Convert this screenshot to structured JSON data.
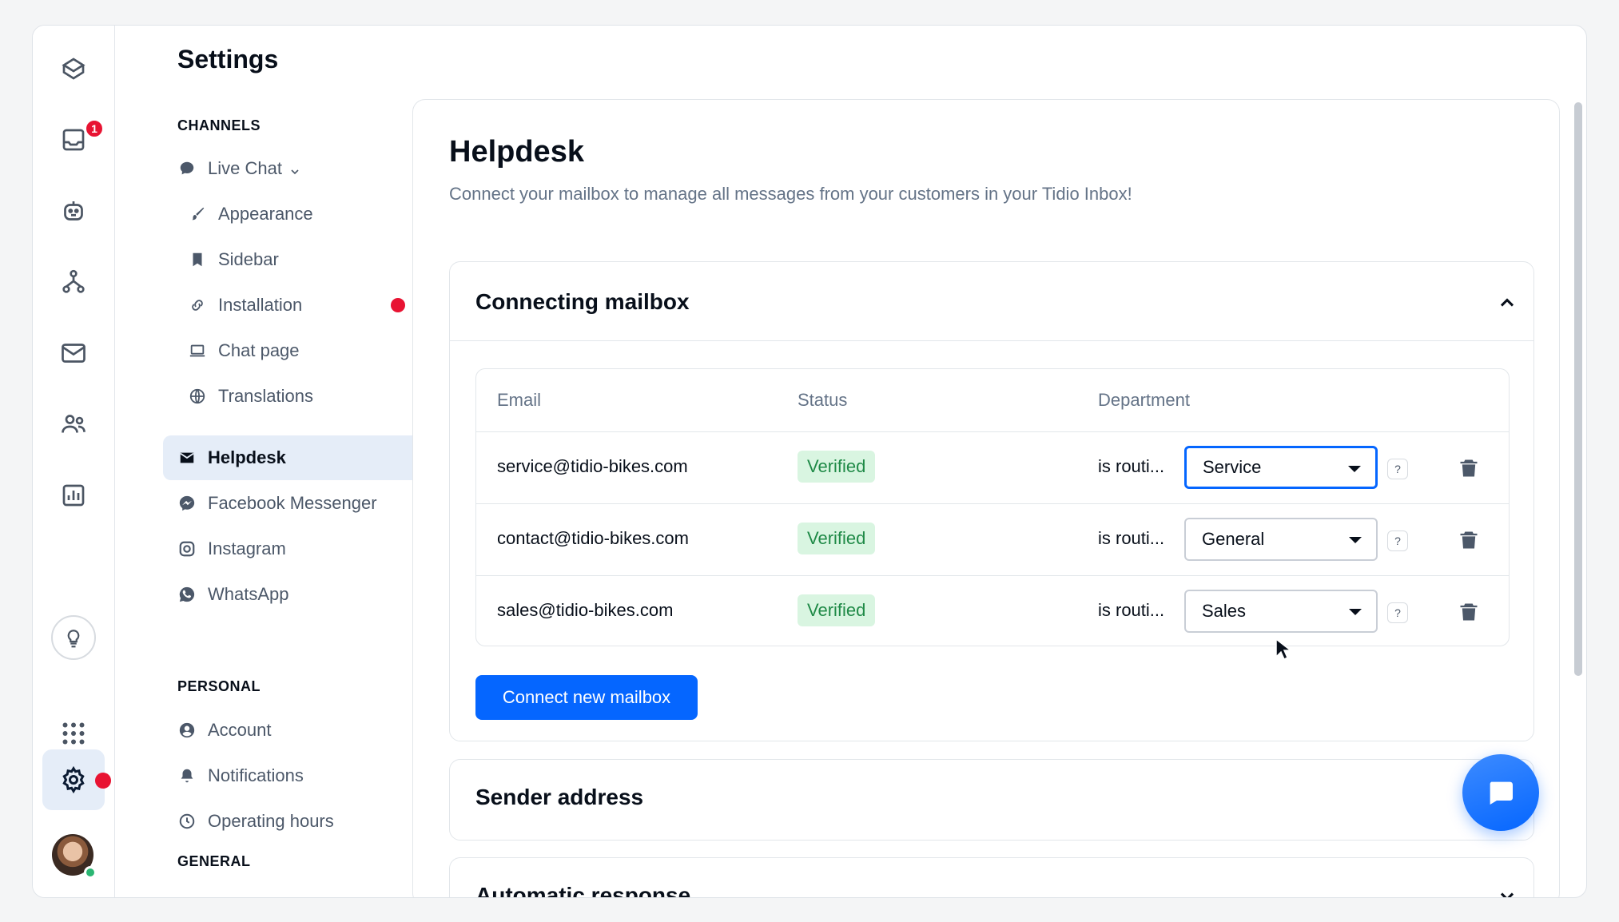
{
  "rail": {
    "inbox_badge": "1"
  },
  "sidebar": {
    "title": "Settings",
    "sections": {
      "channels": "CHANNELS",
      "personal": "PERSONAL",
      "general": "GENERAL"
    },
    "items": {
      "live_chat": "Live Chat",
      "appearance": "Appearance",
      "sidebar": "Sidebar",
      "installation": "Installation",
      "chat_page": "Chat page",
      "translations": "Translations",
      "helpdesk": "Helpdesk",
      "facebook_messenger": "Facebook Messenger",
      "instagram": "Instagram",
      "whatsapp": "WhatsApp",
      "account": "Account",
      "notifications": "Notifications",
      "operating_hours": "Operating hours"
    }
  },
  "main": {
    "title": "Helpdesk",
    "subtitle": "Connect your mailbox to manage all messages from your customers in your Tidio Inbox!",
    "connecting": {
      "title": "Connecting mailbox",
      "columns": [
        "Email",
        "Status",
        "Department"
      ],
      "rows": [
        {
          "email": "service@tidio-bikes.com",
          "status": "Verified",
          "routing": "is routi...",
          "department": "Service",
          "help": "?"
        },
        {
          "email": "contact@tidio-bikes.com",
          "status": "Verified",
          "routing": "is routi...",
          "department": "General",
          "help": "?"
        },
        {
          "email": "sales@tidio-bikes.com",
          "status": "Verified",
          "routing": "is routi...",
          "department": "Sales",
          "help": "?"
        }
      ],
      "connect_button": "Connect new mailbox"
    },
    "sender_address": {
      "title": "Sender address"
    },
    "automatic_response": {
      "title": "Automatic response"
    }
  },
  "colors": {
    "accent": "#0566ff",
    "danger": "#e81332",
    "verified_bg": "#d9f5e1",
    "verified_text": "#1f8a47",
    "active_bg": "#e5edf8"
  }
}
